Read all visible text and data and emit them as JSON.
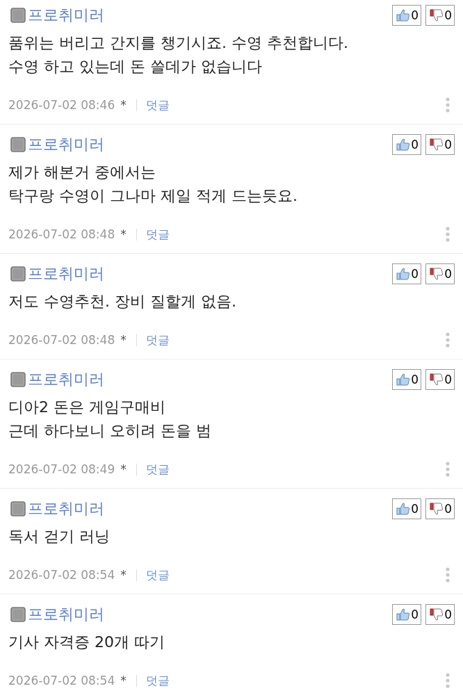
{
  "comments": [
    {
      "author": "프로취미러",
      "likes": "0",
      "dislikes": "0",
      "body": "품위는 버리고 간지를 챙기시죠. 수영 추천합니다.\n수영 하고 있는데 돈 쓸데가 없습니다",
      "date": "2026-07-02 08:46",
      "mark": "*",
      "reply_link": "덧글"
    },
    {
      "author": "프로취미러",
      "likes": "0",
      "dislikes": "0",
      "body": "제가 해본거 중에서는\n탁구랑 수영이 그나마 제일 적게 드는듯요.",
      "date": "2026-07-02 08:48",
      "mark": "*",
      "reply_link": "덧글"
    },
    {
      "author": "프로취미러",
      "likes": "0",
      "dislikes": "0",
      "body": "저도 수영추천. 장비 질할게 없음.",
      "date": "2026-07-02 08:48",
      "mark": "*",
      "reply_link": "덧글"
    },
    {
      "author": "프로취미러",
      "likes": "0",
      "dislikes": "0",
      "body": "디아2 돈은 게임구매비\n근데 하다보니 오히려 돈을 범",
      "date": "2026-07-02 08:49",
      "mark": "*",
      "reply_link": "덧글"
    },
    {
      "author": "프로취미러",
      "likes": "0",
      "dislikes": "0",
      "body": "독서 걷기 러닝",
      "date": "2026-07-02 08:54",
      "mark": "*",
      "reply_link": "덧글"
    },
    {
      "author": "프로취미러",
      "likes": "0",
      "dislikes": "0",
      "body": "기사 자격증 20개 따기",
      "date": "2026-07-02 08:54",
      "mark": "*",
      "reply_link": "덧글"
    }
  ]
}
